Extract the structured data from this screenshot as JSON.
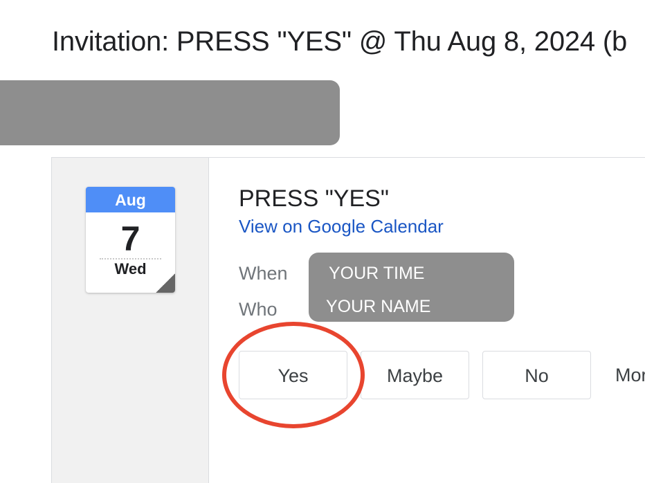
{
  "email": {
    "subject": "Invitation: PRESS \"YES\" @ Thu Aug 8, 2024 (b"
  },
  "calendar_icon": {
    "month": "Aug",
    "day": "7",
    "weekday": "Wed"
  },
  "event": {
    "title": "PRESS \"YES\"",
    "view_link": "View on Google Calendar",
    "when_label": "When",
    "who_label": "Who",
    "when_value": "YOUR TIME",
    "who_value": "YOUR NAME"
  },
  "rsvp": {
    "yes": "Yes",
    "maybe": "Maybe",
    "no": "No",
    "more": "More"
  },
  "colors": {
    "link": "#1a56c4",
    "calendar_header": "#4f8ef7",
    "redaction": "#8e8e8e",
    "highlight": "#e8452f"
  },
  "icons": [
    "calendar-date-icon"
  ]
}
